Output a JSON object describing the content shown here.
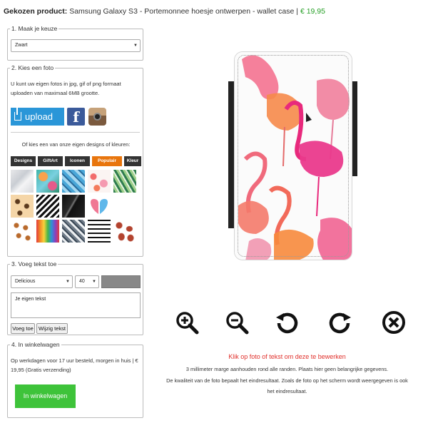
{
  "header": {
    "label": "Gekozen product:",
    "product": "Samsung Galaxy S3 - Portemonnee hoesje ontwerpen - wallet case |",
    "price": "€ 19,95"
  },
  "step1": {
    "title": "1. Maak je keuze",
    "selected": "Zwart"
  },
  "step2": {
    "title": "2. Kies een foto",
    "description": "U kunt uw eigen fotos in jpg, gif of png formaat uploaden van maximaal 6MB grootte.",
    "upload_label": "upload",
    "facebook_label": "f",
    "designs_intro": "Of kies een van onze eigen designs of kleuren:",
    "tabs": [
      "Designs",
      "GiftArt",
      "Iconen",
      "Populair",
      "Kleur"
    ],
    "active_tab": "Populair",
    "thumbnails": [
      "marble",
      "palms",
      "blue-pattern",
      "flamingos",
      "leaves",
      "leopard",
      "chevron",
      "black-marble",
      "hearts",
      "camo",
      "birds",
      "paint-drips",
      "grey-chevron",
      "stripes",
      "lips"
    ]
  },
  "step3": {
    "title": "3. Voeg tekst toe",
    "font": "Delicious",
    "size": "40",
    "placeholder": "Je eigen tekst",
    "add_label": "Voeg toe",
    "edit_label": "Wijzig tekst"
  },
  "step4": {
    "title": "4. In winkelwagen",
    "description": "Op werkdagen voor 17 uur besteld, morgen in huis | € 19,95 (Gratis verzending)",
    "button": "In winkelwagen"
  },
  "tools": [
    "zoom-in-icon",
    "zoom-out-icon",
    "rotate-left-icon",
    "rotate-right-icon",
    "delete-icon"
  ],
  "notes": {
    "click_hint": "Klik op foto of tekst om deze te bewerken",
    "margin_hint": "3 millimeter marge aanhouden rond alle randen. Plaats hier geen belangrijke gegevens.",
    "quality_hint_1": "De kwaliteit van de foto bepaalt het eindresultaat. Zoals de foto op het scherm wordt weergegeven is ook",
    "quality_hint_2": "het eindresultaat."
  },
  "colors": {
    "accent_green": "#27a027",
    "upload_blue": "#2a96d8",
    "facebook_blue": "#3b5a9a",
    "tab_active": "#e8750d",
    "cart_green": "#3ec33a",
    "hint_red": "#e0302b"
  }
}
